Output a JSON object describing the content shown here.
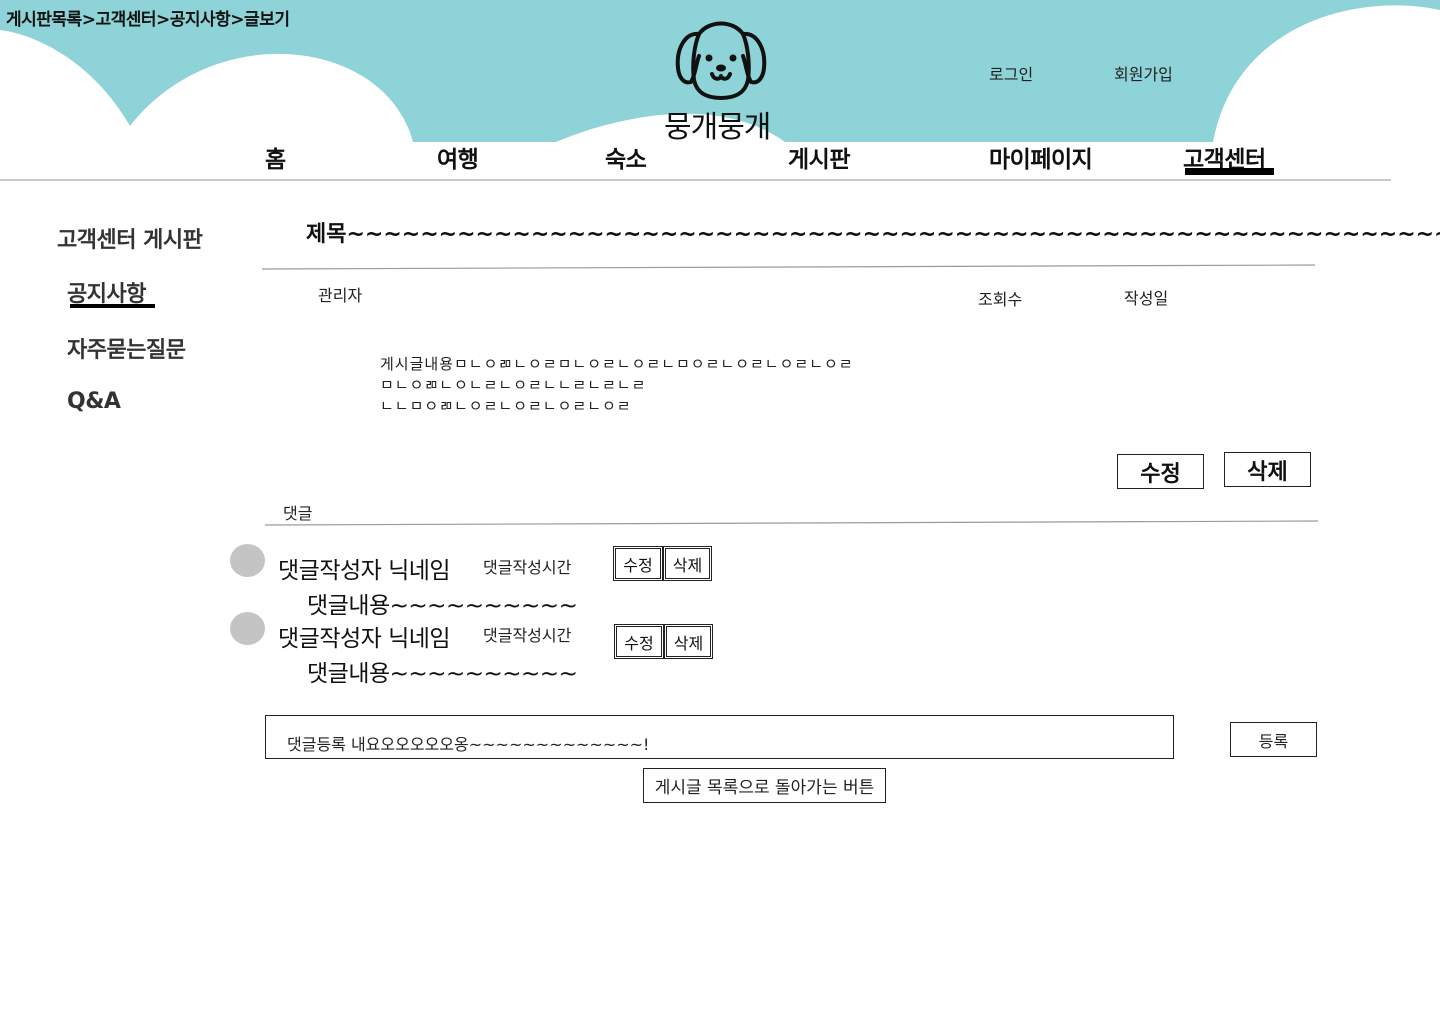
{
  "breadcrumb": "게시판목록>고객센터>공지사항>글보기",
  "brand": {
    "name": "뭉개뭉개",
    "logo_icon": "dog-face-icon",
    "header_color": "#8DD3D7"
  },
  "auth": {
    "login": "로그인",
    "signup": "회원가입"
  },
  "nav": {
    "items": [
      "홈",
      "여행",
      "숙소",
      "게시판",
      "마이페이지",
      "고객센터"
    ],
    "active": "고객센터"
  },
  "sidebar": {
    "title": "고객센터 게시판",
    "items": [
      "공지사항",
      "자주묻는질문",
      "Q&A"
    ],
    "active": "공지사항"
  },
  "post": {
    "title": "제목~~~~~~~~~~~~~~~~~~~~~~~~~~~~~~~~~~~~~~~~~~~~~~~~~~~~~~~~~~~~",
    "author": "관리자",
    "views_label": "조회수",
    "date_label": "작성일",
    "body_lines": [
      "게시글내용ㅁㄴㅇㄻㄴㅇㄹㅁㄴㅇㄹㄴㅇㄹㄴㅁㅇㄹㄴㅇㄹㄴㅇㄹㄴㅇㄹ",
      "ㅁㄴㅇㄻㄴㅇㄴㄹㄴㅇㄹㄴㄴㄹㄴㄹㄴㄹ",
      "ㄴㄴㅁㅇㄻㄴㅇㄹㄴㅇㄹㄴㅇㄹㄴㅇㄹ"
    ],
    "edit_label": "수정",
    "delete_label": "삭제"
  },
  "comments": {
    "label": "댓글",
    "avatar_color": "#C4C4C4",
    "items": [
      {
        "author": "댓글작성자 닉네임",
        "time": "댓글작성시간",
        "content": "댓글내용~~~~~~~~~~",
        "edit_label": "수정",
        "delete_label": "삭제"
      },
      {
        "author": "댓글작성자 닉네임",
        "time": "댓글작성시간",
        "content": "댓글내용~~~~~~~~~~",
        "edit_label": "수정",
        "delete_label": "삭제"
      }
    ]
  },
  "comment_form": {
    "value": "댓글등록 내요오오오오오옹~~~~~~~~~~~~~!",
    "submit": "등록"
  },
  "back_button": "게시글 목록으로 돌아가는 버튼"
}
